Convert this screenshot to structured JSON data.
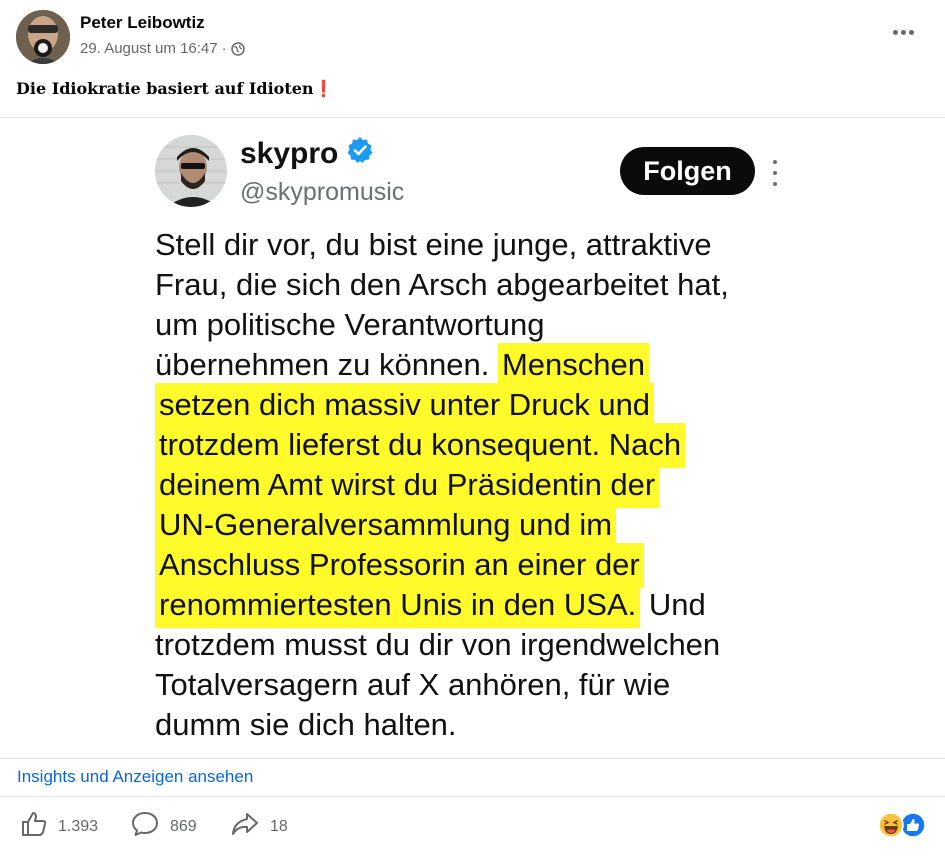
{
  "post": {
    "author": "Peter Leibowtiz",
    "timestamp": "29. August um 16:47",
    "separator": "·",
    "caption": "Die Idiokratie basiert auf Idioten",
    "caption_emoji": "❗"
  },
  "tweet": {
    "display_name": "skypro",
    "handle": "@skypromusic",
    "follow_label": "Folgen",
    "lines": [
      {
        "plain": "Stell dir vor, du bist eine junge, attraktive",
        "hl": "",
        "after": ""
      },
      {
        "plain": "Frau, die sich den Arsch abgearbeitet hat,",
        "hl": "",
        "after": ""
      },
      {
        "plain": "um politische Verantwortung",
        "hl": "",
        "after": ""
      },
      {
        "plain": "übernehmen zu können. ",
        "hl": "Menschen",
        "after": ""
      },
      {
        "plain": "",
        "hl": "setzen dich massiv unter Druck und",
        "after": ""
      },
      {
        "plain": "",
        "hl": "trotzdem lieferst du konsequent. Nach",
        "after": ""
      },
      {
        "plain": "",
        "hl": "deinem Amt wirst du Präsidentin der",
        "after": ""
      },
      {
        "plain": "",
        "hl": "UN-Generalversammlung und im",
        "after": ""
      },
      {
        "plain": "",
        "hl": "Anschluss Professorin an einer der",
        "after": ""
      },
      {
        "plain": "",
        "hl": "renommiertesten Unis in den USA.",
        "after": " Und"
      },
      {
        "plain": "trotzdem musst du dir von irgendwelchen",
        "hl": "",
        "after": ""
      },
      {
        "plain": "Totalversagern auf X anhören, für wie",
        "hl": "",
        "after": ""
      },
      {
        "plain": "dumm sie dich halten.",
        "hl": "",
        "after": ""
      }
    ],
    "highlight_color": "#fffb2b"
  },
  "footer": {
    "insights_label": "Insights und Anzeigen ansehen",
    "likes": "1.393",
    "comments": "869",
    "shares": "18",
    "icons": {
      "like": "thumbs-up-icon",
      "comment": "comment-bubble-icon",
      "share": "share-arrow-icon",
      "reactions": [
        "haha-reaction-icon",
        "like-reaction-icon"
      ]
    }
  },
  "colors": {
    "link": "#0a66d8",
    "meta": "#65676b",
    "verified": "#1d9bf0"
  }
}
